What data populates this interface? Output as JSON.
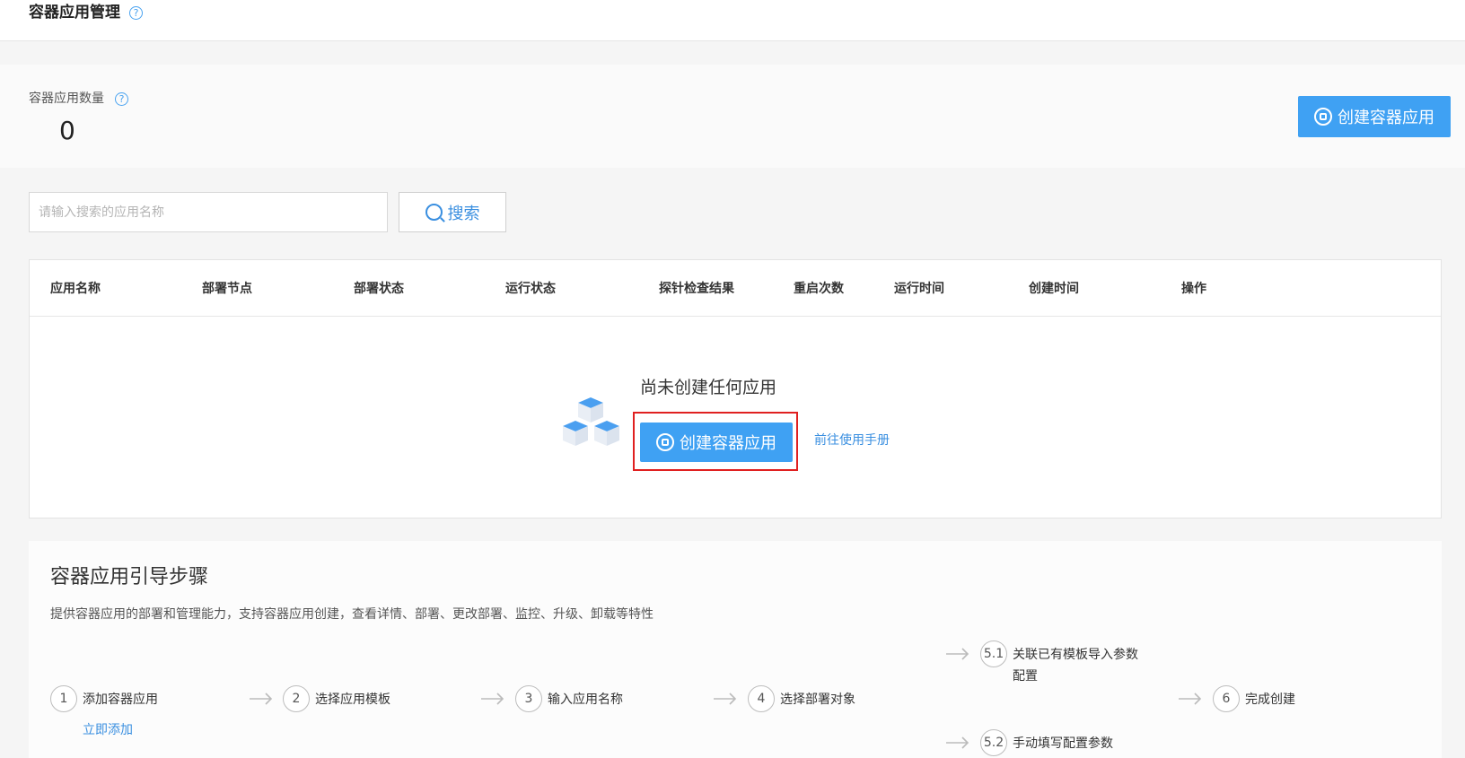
{
  "header": {
    "title": "容器应用管理",
    "help": "?"
  },
  "summary": {
    "label": "容器应用数量",
    "help": "?",
    "count": "0",
    "create_button": "创建容器应用"
  },
  "search": {
    "placeholder": "请输入搜索的应用名称",
    "button": "搜索"
  },
  "table": {
    "columns": [
      "应用名称",
      "部署节点",
      "部署状态",
      "运行状态",
      "探针检查结果",
      "重启次数",
      "运行时间",
      "创建时间",
      "操作"
    ],
    "empty": {
      "title": "尚未创建任何应用",
      "create_button": "创建容器应用",
      "manual_link": "前往使用手册"
    }
  },
  "guide": {
    "title": "容器应用引导步骤",
    "description": "提供容器应用的部署和管理能力，支持容器应用创建，查看详情、部署、更改部署、监控、升级、卸载等特性",
    "steps": [
      {
        "num": "1",
        "label": "添加容器应用"
      },
      {
        "num": "2",
        "label": "选择应用模板"
      },
      {
        "num": "3",
        "label": "输入应用名称"
      },
      {
        "num": "4",
        "label": "选择部署对象"
      },
      {
        "num": "5.1",
        "label": "关联已有模板导入参数",
        "label_line2": "配置"
      },
      {
        "num": "5.2",
        "label": "手动填写配置参数"
      },
      {
        "num": "6",
        "label": "完成创建"
      }
    ],
    "add_link": "立即添加"
  },
  "colors": {
    "primary": "#3fa1f3",
    "link": "#3a8fe0",
    "highlight": "#e02020"
  }
}
